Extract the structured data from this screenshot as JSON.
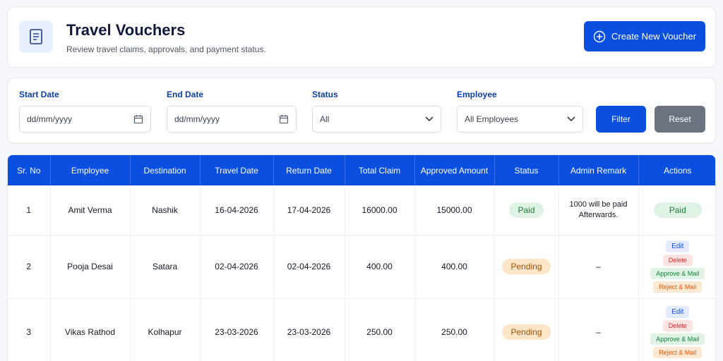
{
  "header": {
    "title": "Travel Vouchers",
    "subtitle": "Review travel claims, approvals, and payment status.",
    "icon": "receipt-icon",
    "create_button": "Create New Voucher"
  },
  "filters": {
    "start_date": {
      "label": "Start Date",
      "placeholder": "dd/mm/yyyy"
    },
    "end_date": {
      "label": "End Date",
      "placeholder": "dd/mm/yyyy"
    },
    "status": {
      "label": "Status",
      "value": "All"
    },
    "employee": {
      "label": "Employee",
      "value": "All Employees"
    },
    "filter_button": "Filter",
    "reset_button": "Reset"
  },
  "table": {
    "columns": [
      "Sr. No",
      "Employee",
      "Destination",
      "Travel Date",
      "Return Date",
      "Total Claim",
      "Approved Amount",
      "Status",
      "Admin Remark",
      "Actions"
    ],
    "rows": [
      {
        "sr": "1",
        "employee": "Amit Verma",
        "destination": "Nashik",
        "travel_date": "16-04-2026",
        "return_date": "17-04-2026",
        "total_claim": "16000.00",
        "approved_amount": "15000.00",
        "status": "Paid",
        "remark_line1": "1000 will be paid",
        "remark_line2": "Afterwards.",
        "action_status": "Paid"
      },
      {
        "sr": "2",
        "employee": "Pooja Desai",
        "destination": "Satara",
        "travel_date": "02-04-2026",
        "return_date": "02-04-2026",
        "total_claim": "400.00",
        "approved_amount": "400.00",
        "status": "Pending",
        "remark": "–",
        "actions": {
          "edit": "Edit",
          "delete": "Delete",
          "approve": "Approve & Mail",
          "reject": "Reject & Mail"
        }
      },
      {
        "sr": "3",
        "employee": "Vikas Rathod",
        "destination": "Kolhapur",
        "travel_date": "23-03-2026",
        "return_date": "23-03-2026",
        "total_claim": "250.00",
        "approved_amount": "250.00",
        "status": "Pending",
        "remark": "–",
        "actions": {
          "edit": "Edit",
          "delete": "Delete",
          "approve": "Approve & Mail",
          "reject": "Reject & Mail"
        }
      }
    ]
  },
  "colors": {
    "primary": "#0b4fe0",
    "reset": "#6b7280",
    "paid": "#dff3e4",
    "pending": "#fde5c8"
  }
}
